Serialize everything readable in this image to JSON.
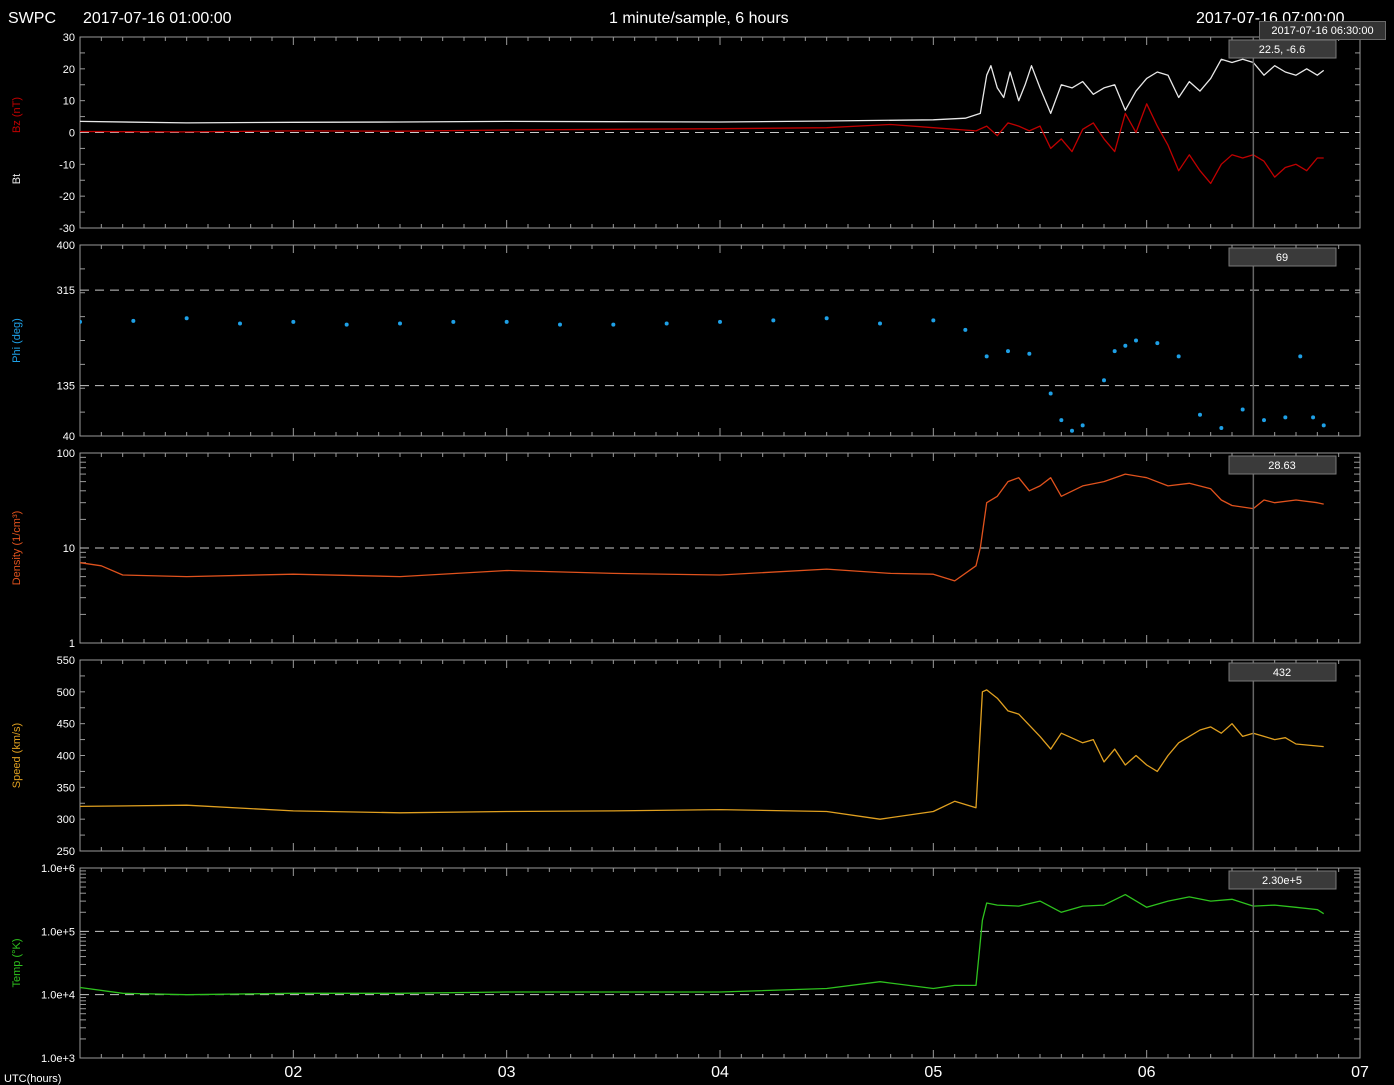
{
  "header": {
    "brand": "SWPC",
    "start_time": "2017-07-16 01:00:00",
    "cadence": "1 minute/sample, 6 hours",
    "end_time": "2017-07-16 07:00:00"
  },
  "cursor": {
    "tooltip": "2017-07-16 06:30:00",
    "time_hours": 6.5
  },
  "colors": {
    "background": "#000000",
    "frame": "#9a9a9a",
    "bz": "#c00000",
    "bt": "#e8e8e8",
    "phi": "#1ea0e6",
    "density": "#e0521d",
    "speed": "#e0a020",
    "temp": "#2ec21e"
  },
  "chart_data": [
    {
      "type": "line",
      "panel": "mag",
      "ylabel_parts": [
        "Bz (nT)",
        "Bt"
      ],
      "ylim": [
        -30,
        30
      ],
      "yticks": [
        "30",
        "20",
        "10",
        "0",
        "-10",
        "-20",
        "-30"
      ],
      "ytick_values": [
        30,
        20,
        10,
        0,
        -10,
        -20,
        -30
      ],
      "dashed_lines": [
        0
      ],
      "readout": "22.5, -6.6",
      "series": [
        {
          "name": "Bt",
          "x": [
            1.0,
            1.5,
            2.0,
            2.5,
            3.0,
            3.5,
            4.0,
            4.5,
            5.0,
            5.15,
            5.22,
            5.25,
            5.27,
            5.3,
            5.33,
            5.36,
            5.4,
            5.43,
            5.46,
            5.5,
            5.55,
            5.6,
            5.65,
            5.7,
            5.75,
            5.8,
            5.85,
            5.9,
            5.95,
            6.0,
            6.05,
            6.1,
            6.15,
            6.2,
            6.25,
            6.3,
            6.35,
            6.4,
            6.45,
            6.5,
            6.55,
            6.6,
            6.65,
            6.7,
            6.75,
            6.8,
            6.83
          ],
          "y": [
            3.5,
            3.0,
            3.2,
            3.3,
            3.5,
            3.4,
            3.3,
            3.6,
            4.0,
            4.5,
            6,
            18,
            21,
            14,
            11,
            19,
            10,
            15,
            21,
            14,
            6,
            15,
            14,
            16,
            12,
            14,
            15,
            7,
            13,
            17,
            19,
            18,
            11,
            16,
            13,
            17,
            23,
            22,
            23,
            22,
            18,
            21,
            19,
            18,
            20,
            18,
            19.5
          ]
        },
        {
          "name": "Bz",
          "x": [
            1.0,
            1.5,
            2.0,
            2.5,
            3.0,
            3.5,
            4.0,
            4.5,
            4.8,
            5.0,
            5.2,
            5.25,
            5.3,
            5.35,
            5.4,
            5.45,
            5.5,
            5.55,
            5.6,
            5.65,
            5.7,
            5.75,
            5.8,
            5.85,
            5.9,
            5.95,
            6.0,
            6.05,
            6.1,
            6.15,
            6.2,
            6.25,
            6.3,
            6.35,
            6.4,
            6.45,
            6.5,
            6.55,
            6.6,
            6.65,
            6.7,
            6.75,
            6.8,
            6.83
          ],
          "y": [
            0.3,
            0.2,
            0.5,
            0.4,
            0.8,
            1.0,
            1.2,
            1.5,
            2.5,
            1.5,
            0.5,
            2,
            -1,
            3,
            2,
            0.5,
            2,
            -5,
            -2,
            -6,
            1,
            3,
            -2,
            -6,
            6,
            0,
            9,
            2,
            -4,
            -12,
            -7,
            -12,
            -16,
            -10,
            -7,
            -8,
            -7,
            -9,
            -14,
            -11,
            -10,
            -12,
            -8,
            -8
          ]
        }
      ]
    },
    {
      "type": "scatter",
      "panel": "phi",
      "ylabel": "Phi (deg)",
      "ylim": [
        40,
        400
      ],
      "yticks": [
        "400",
        "315",
        "135",
        "40"
      ],
      "ytick_values": [
        400,
        315,
        135,
        40
      ],
      "dashed_lines": [
        315,
        135
      ],
      "readout": "69",
      "series": [
        {
          "name": "Phi",
          "x": [
            1.0,
            1.25,
            1.5,
            1.75,
            2.0,
            2.25,
            2.5,
            2.75,
            3.0,
            3.25,
            3.5,
            3.75,
            4.0,
            4.25,
            4.5,
            4.75,
            5.0,
            5.15,
            5.25,
            5.35,
            5.45,
            5.55,
            5.6,
            5.65,
            5.7,
            5.8,
            5.85,
            5.9,
            5.95,
            6.05,
            6.15,
            6.25,
            6.35,
            6.45,
            6.55,
            6.65,
            6.72,
            6.78,
            6.83
          ],
          "y": [
            255,
            257,
            262,
            252,
            255,
            250,
            252,
            255,
            255,
            250,
            250,
            252,
            255,
            258,
            262,
            252,
            258,
            240,
            190,
            200,
            195,
            120,
            70,
            50,
            60,
            145,
            200,
            210,
            220,
            215,
            190,
            80,
            55,
            90,
            70,
            75,
            190,
            75,
            60
          ]
        }
      ]
    },
    {
      "type": "line",
      "panel": "density",
      "ylabel": "Density (1/cm³)",
      "ylim": [
        1,
        100
      ],
      "log_scale": true,
      "yticks": [
        "100",
        "10",
        "1"
      ],
      "ytick_values": [
        100,
        10,
        1
      ],
      "dashed_lines": [
        10
      ],
      "readout": "28.63",
      "series": [
        {
          "name": "Density",
          "x": [
            1.0,
            1.1,
            1.2,
            1.5,
            2.0,
            2.5,
            3.0,
            3.5,
            4.0,
            4.5,
            4.8,
            5.0,
            5.1,
            5.2,
            5.22,
            5.25,
            5.3,
            5.35,
            5.4,
            5.45,
            5.5,
            5.55,
            5.6,
            5.7,
            5.8,
            5.9,
            6.0,
            6.1,
            6.2,
            6.3,
            6.35,
            6.4,
            6.5,
            6.55,
            6.6,
            6.7,
            6.8,
            6.83
          ],
          "y": [
            7,
            6.5,
            5.2,
            5.0,
            5.3,
            5.0,
            5.8,
            5.4,
            5.2,
            6.0,
            5.4,
            5.3,
            4.5,
            6.5,
            10,
            30,
            35,
            50,
            55,
            40,
            45,
            55,
            35,
            45,
            50,
            60,
            55,
            45,
            48,
            42,
            32,
            28,
            26,
            32,
            30,
            32,
            30,
            29
          ]
        }
      ]
    },
    {
      "type": "line",
      "panel": "speed",
      "ylabel": "Speed (km/s)",
      "ylim": [
        250,
        550
      ],
      "yticks": [
        "550",
        "500",
        "450",
        "400",
        "350",
        "300",
        "250"
      ],
      "ytick_values": [
        550,
        500,
        450,
        400,
        350,
        300,
        250
      ],
      "dashed_lines": [],
      "readout": "432",
      "series": [
        {
          "name": "Speed",
          "x": [
            1.0,
            1.5,
            2.0,
            2.5,
            3.0,
            3.5,
            4.0,
            4.5,
            4.75,
            5.0,
            5.1,
            5.2,
            5.23,
            5.25,
            5.3,
            5.35,
            5.4,
            5.5,
            5.55,
            5.6,
            5.7,
            5.75,
            5.8,
            5.85,
            5.9,
            5.95,
            6.0,
            6.05,
            6.1,
            6.15,
            6.2,
            6.25,
            6.3,
            6.35,
            6.4,
            6.45,
            6.5,
            6.55,
            6.6,
            6.65,
            6.7,
            6.8,
            6.83
          ],
          "y": [
            320,
            322,
            313,
            310,
            312,
            313,
            315,
            312,
            300,
            312,
            328,
            318,
            500,
            503,
            490,
            470,
            465,
            430,
            410,
            435,
            420,
            425,
            390,
            410,
            385,
            400,
            385,
            375,
            400,
            420,
            430,
            440,
            445,
            435,
            450,
            430,
            435,
            430,
            425,
            428,
            418,
            415,
            414
          ]
        }
      ]
    },
    {
      "type": "line",
      "panel": "temp",
      "ylabel": "Temp (°K)",
      "ylim": [
        1000,
        1000000
      ],
      "log_scale": true,
      "yticks": [
        "1.0e+6",
        "1.0e+5",
        "1.0e+4",
        "1.0e+3"
      ],
      "ytick_values": [
        1000000,
        100000,
        10000,
        1000
      ],
      "dashed_lines": [
        100000,
        10000
      ],
      "readout": "2.30e+5",
      "series": [
        {
          "name": "Temp",
          "x": [
            1.0,
            1.2,
            1.5,
            2.0,
            2.5,
            3.0,
            3.5,
            4.0,
            4.5,
            4.75,
            5.0,
            5.1,
            5.2,
            5.23,
            5.25,
            5.3,
            5.4,
            5.5,
            5.6,
            5.7,
            5.8,
            5.9,
            6.0,
            6.1,
            6.2,
            6.3,
            6.4,
            6.5,
            6.6,
            6.7,
            6.8,
            6.83
          ],
          "y": [
            13000,
            10500,
            10000,
            10500,
            10500,
            11000,
            11000,
            11000,
            12500,
            16000,
            12500,
            14000,
            14000,
            150000,
            280000,
            260000,
            250000,
            300000,
            200000,
            250000,
            260000,
            380000,
            240000,
            300000,
            350000,
            300000,
            320000,
            250000,
            260000,
            240000,
            220000,
            190000
          ]
        }
      ]
    }
  ],
  "x_axis": {
    "title": "UTC(hours)",
    "xlim": [
      1,
      7
    ],
    "ticks": [
      "02",
      "03",
      "04",
      "05",
      "06",
      "07"
    ],
    "tick_values": [
      2,
      3,
      4,
      5,
      6,
      7
    ]
  }
}
